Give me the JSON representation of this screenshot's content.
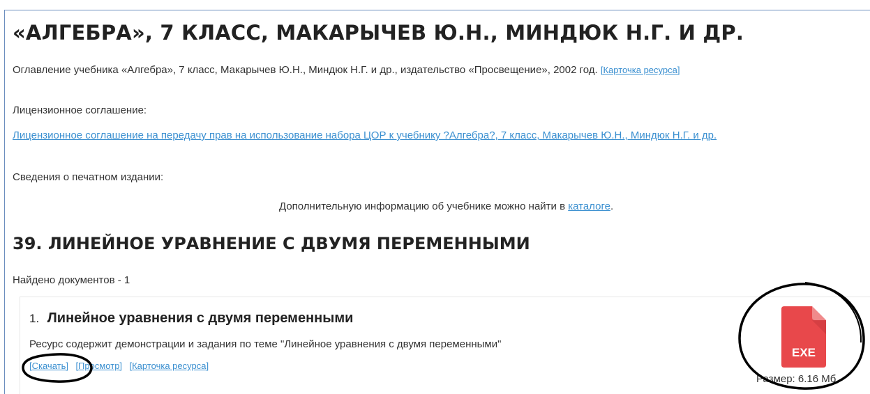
{
  "header": {
    "title": "«АЛГЕБРА», 7 КЛАСС, МАКАРЫЧЕВ Ю.Н., МИНДЮК Н.Г. И ДР.",
    "description": "Оглавление учебника «Алгебра», 7 класс, Макарычев Ю.Н., Миндюк Н.Г. и др., издательство «Просвещение», 2002 год.",
    "resource_card_link": "[Карточка ресурса]"
  },
  "license": {
    "label": "Лицензионное соглашение:",
    "link_text": "Лицензионное соглашение на передачу прав на использование набора ЦОР к учебнику ?Алгебра?, 7 класс, Макарычев Ю.Н., Миндюк Н.Г. и др."
  },
  "print_edition": {
    "label": "Сведения о печатном издании:",
    "info_text": "Дополнительную информацию об учебнике можно найти в",
    "catalog_link": "каталоге",
    "info_suffix": "."
  },
  "section": {
    "title": "39. ЛИНЕЙНОЕ УРАВНЕНИЕ С ДВУМЯ ПЕРЕМЕННЫМИ",
    "found_text": "Найдено документов - 1"
  },
  "document": {
    "number": "1.",
    "title": "Линейное уравнения с двумя переменными",
    "description": "Ресурс содержит демонстрации и задания по теме \"Линейное уравнения с двумя переменными\"",
    "download_link": "[Скачать]",
    "view_link": "[Просмотр]",
    "card_link": "[Карточка ресурса]",
    "file_type": "EXE",
    "size_text": "Размер: 6.16 Мб"
  },
  "colors": {
    "link": "#3a8fd0",
    "file_icon": "#e8484b",
    "file_icon_fold": "#f08a8b",
    "annotation": "#000000"
  },
  "icons": {
    "file": "exe-file-icon"
  }
}
